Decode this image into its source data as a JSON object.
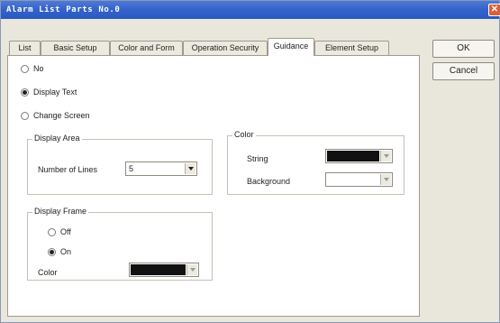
{
  "window": {
    "title": "Alarm List Parts No.0",
    "close_symbol": "✕"
  },
  "tabs": [
    {
      "label": "List"
    },
    {
      "label": "Basic Setup"
    },
    {
      "label": "Color and Form"
    },
    {
      "label": "Operation Security"
    },
    {
      "label": "Guidance"
    },
    {
      "label": "Element Setup"
    }
  ],
  "active_tab": "Guidance",
  "buttons": {
    "ok": "OK",
    "cancel": "Cancel"
  },
  "guidance_options": [
    {
      "label": "No",
      "checked": false
    },
    {
      "label": "Display Text",
      "checked": true
    },
    {
      "label": "Change Screen",
      "checked": false
    }
  ],
  "display_area": {
    "title": "Display Area",
    "lines_label": "Number of Lines",
    "lines_value": "5"
  },
  "color_group": {
    "title": "Color",
    "string_label": "String",
    "string_color": "#111111",
    "background_label": "Background",
    "background_color": "#ffffff"
  },
  "display_frame": {
    "title": "Display Frame",
    "options": [
      {
        "label": "Off",
        "checked": false
      },
      {
        "label": "On",
        "checked": true
      }
    ],
    "color_label": "Color",
    "color_value": "#111111"
  }
}
